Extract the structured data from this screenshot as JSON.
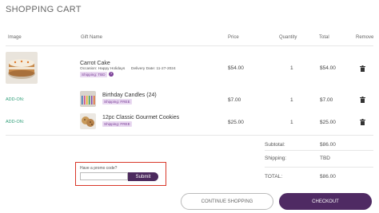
{
  "page_title": "SHOPPING CART",
  "columns": [
    "Image",
    "Gift Name",
    "Price",
    "Quantity",
    "Total",
    "Remove"
  ],
  "items": [
    {
      "type_label": "",
      "name": "Carrot Cake",
      "occasion": "Occasion: Happy Holidays",
      "delivery": "Delivery Date: 11-27-2024",
      "shipping": "Shipping: TBD",
      "price": "$54.00",
      "quantity": "1",
      "total": "$54.00",
      "info_icon": "help-circle-icon"
    },
    {
      "type_label": "ADD-ON:",
      "name": "Birthday Candles (24)",
      "shipping": "Shipping: FREE",
      "price": "$7.00",
      "quantity": "1",
      "total": "$7.00"
    },
    {
      "type_label": "ADD-ON:",
      "name": "12pc Classic Gourmet Cookies",
      "shipping": "Shipping: FREE",
      "price": "$25.00",
      "quantity": "1",
      "total": "$25.00"
    }
  ],
  "summary": {
    "subtotal_label": "Subtotal:",
    "subtotal_value": "$86.00",
    "shipping_label": "Shipping:",
    "shipping_value": "TBD",
    "total_label": "TOTAL:",
    "total_value": "$86.00"
  },
  "promo": {
    "label": "Have a promo code?",
    "placeholder": "",
    "submit_label": "Submit"
  },
  "buttons": {
    "continue_label": "CONTINUE SHOPPING",
    "checkout_label": "CHECKOUT"
  },
  "colors": {
    "brand": "#4f2a63",
    "addon_green": "#2f9e78",
    "pill_bg": "#e9d9f1",
    "pill_text": "#7b3f98",
    "highlight": "#d9382a"
  }
}
